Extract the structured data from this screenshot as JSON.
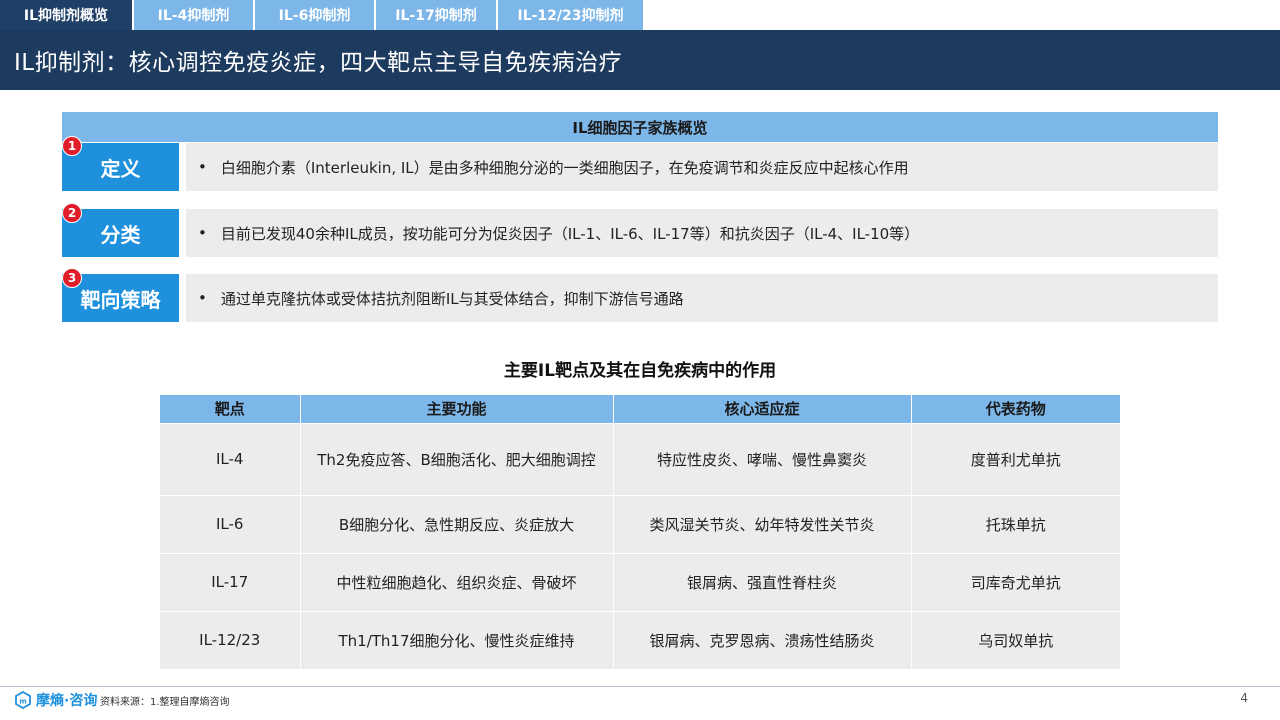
{
  "tabs": [
    {
      "label": "IL抑制剂概览",
      "active": true
    },
    {
      "label": "IL-4抑制剂",
      "active": false
    },
    {
      "label": "IL-6抑制剂",
      "active": false
    },
    {
      "label": "IL-17抑制剂",
      "active": false
    },
    {
      "label": "IL-12/23抑制剂",
      "active": false
    }
  ],
  "title": "IL抑制剂：核心调控免疫炎症，四大靶点主导自免疾病治疗",
  "overview": {
    "heading": "IL细胞因子家族概览",
    "rows": [
      {
        "num": "1",
        "label": "定义",
        "bullet": "•",
        "text": "白细胞介素（Interleukin, IL）是由多种细胞分泌的一类细胞因子，在免疫调节和炎症反应中起核心作用"
      },
      {
        "num": "2",
        "label": "分类",
        "bullet": "•",
        "text": "目前已发现40余种IL成员，按功能可分为促炎因子（IL-1、IL-6、IL-17等）和抗炎因子（IL-4、IL-10等）"
      },
      {
        "num": "3",
        "label": "靶向策略",
        "bullet": "•",
        "text": "通过单克隆抗体或受体拮抗剂阻断IL与其受体结合，抑制下游信号通路"
      }
    ]
  },
  "table": {
    "title": "主要IL靶点及其在自免疾病中的作用",
    "headers": [
      "靶点",
      "主要功能",
      "核心适应症",
      "代表药物"
    ],
    "rows": [
      [
        "IL-4",
        "Th2免疫应答、B细胞活化、肥大细胞调控",
        "特应性皮炎、哮喘、慢性鼻窦炎",
        "度普利尤单抗"
      ],
      [
        "IL-6",
        "B细胞分化、急性期反应、炎症放大",
        "类风湿关节炎、幼年特发性关节炎",
        "托珠单抗"
      ],
      [
        "IL-17",
        "中性粒细胞趋化、组织炎症、骨破坏",
        "银屑病、强直性脊柱炎",
        "司库奇尤单抗"
      ],
      [
        "IL-12/23",
        "Th1/Th17细胞分化、慢性炎症维持",
        "银屑病、克罗恩病、溃疡性结肠炎",
        "乌司奴单抗"
      ]
    ]
  },
  "footer": {
    "logo_text": "摩熵·咨询",
    "logo_icon": "hexagon-logo-icon",
    "source": "资料来源：1.整理自摩熵咨询",
    "page": "4"
  },
  "colors": {
    "navy": "#1d3a5f",
    "tab_light": "#7db6e8",
    "label_blue": "#1e90dc",
    "badge_red": "#e11d2a",
    "row_gray": "#ececec"
  }
}
